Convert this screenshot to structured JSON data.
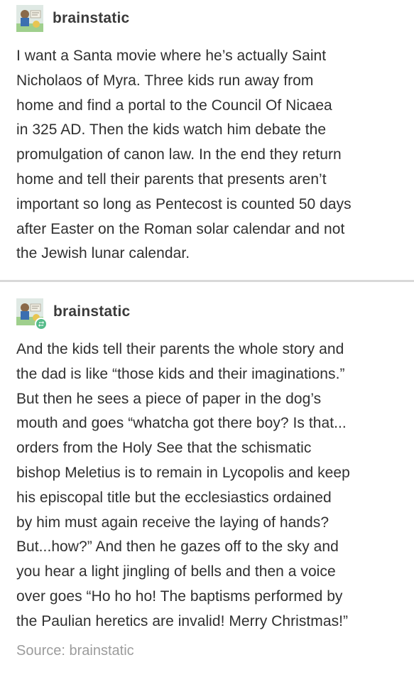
{
  "post1": {
    "username": "brainstatic",
    "avatar_icon": "brainstatic-avatar-icon",
    "body": "I want a Santa movie where he’s actually Saint\nNicholaos of Myra. Three kids run away from\nhome and find a portal to the Council Of Nicaea\nin 325 AD. Then the kids watch him debate the\npromulgation of canon law. In the end they return\nhome and tell their parents that presents aren’t\nimportant so long as Pentecost is counted 50 days\nafter Easter on the Roman solar calendar and not\nthe Jewish lunar calendar."
  },
  "post2": {
    "username": "brainstatic",
    "avatar_icon": "brainstatic-avatar-icon",
    "badge_icon": "reblog-icon",
    "body": "And the kids tell their parents the whole story and\nthe dad is like “those kids and their imaginations.”\nBut then he sees a piece of paper in the dog’s\nmouth and goes “whatcha got there boy? Is that...\norders from the Holy See that the schismatic\nbishop Meletius is to remain in Lycopolis and keep\nhis episcopal title but the ecclesiastics ordained\nby him must again receive the laying of hands?\nBut...how?” And then he gazes off to the sky and\nyou hear a light jingling of bells and then a voice\nover goes “Ho ho ho! The baptisms performed by\nthe Paulian heretics are invalid! Merry Christmas!”"
  },
  "footer": {
    "source_label": "Source: brainstatic"
  },
  "colors": {
    "text": "#303030",
    "divider": "#d8d8d8",
    "source": "#9c9c9c",
    "reblog_badge": "#56bc8a"
  }
}
